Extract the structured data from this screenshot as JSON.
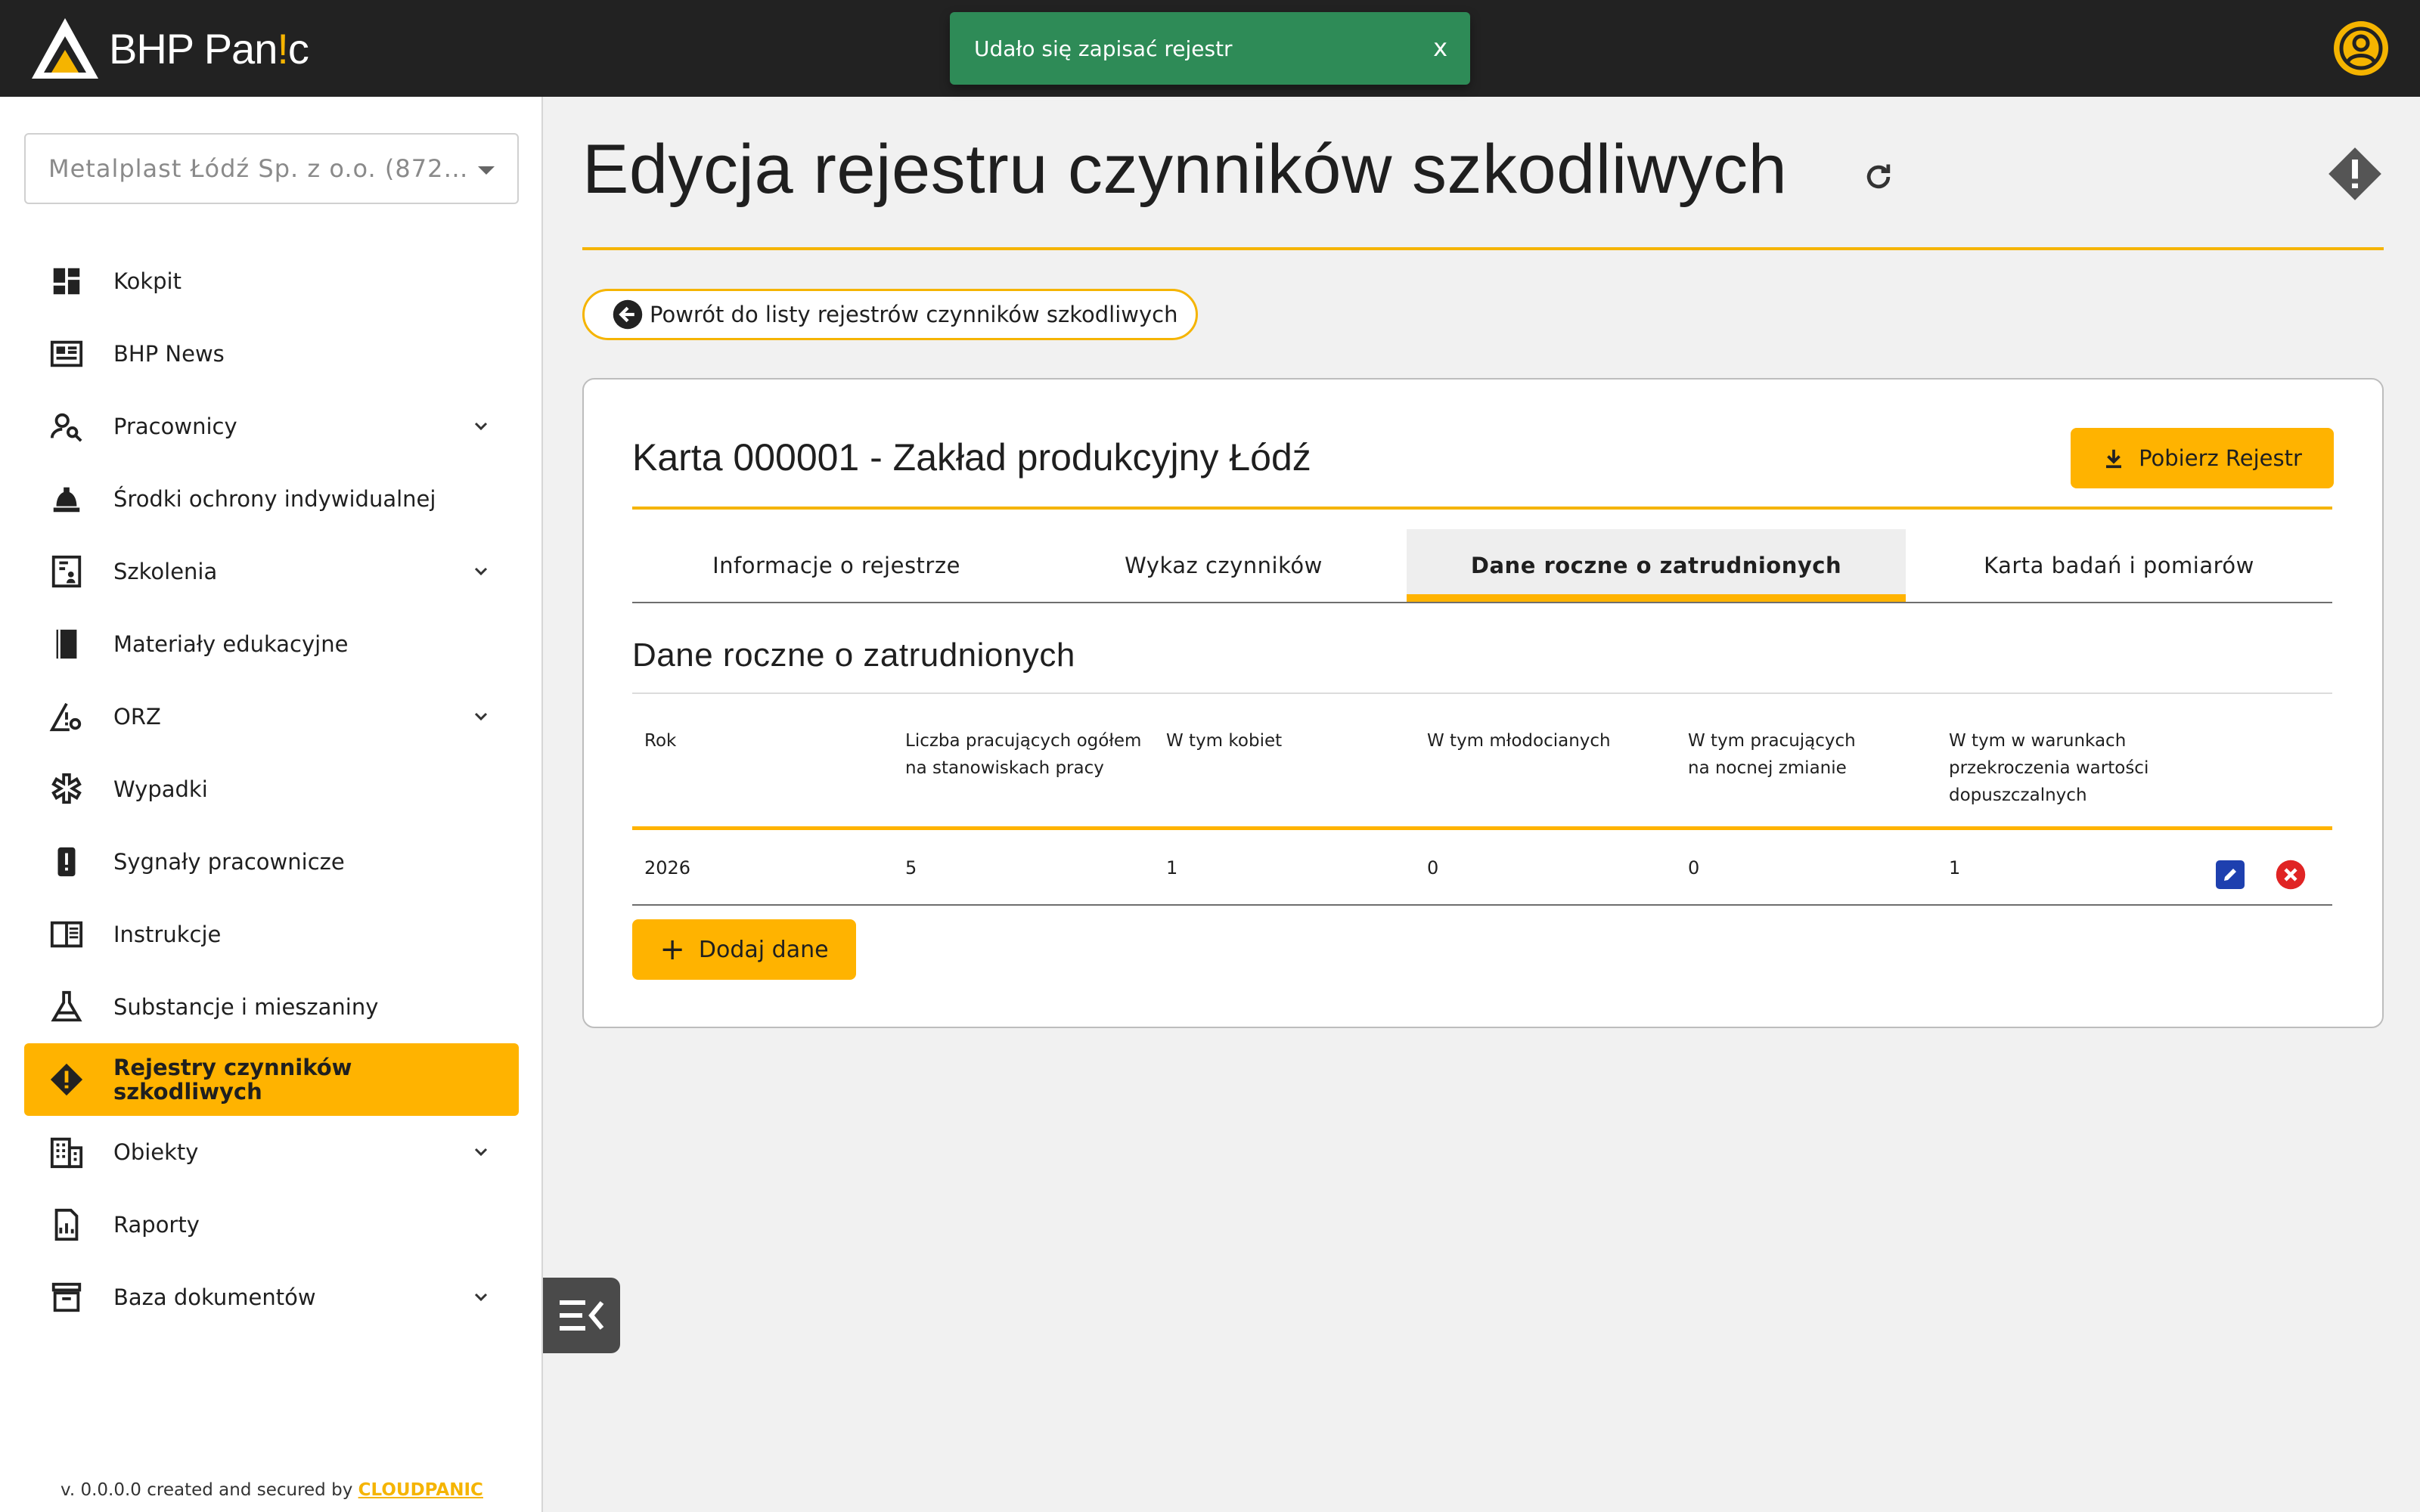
{
  "brand": {
    "name_part1": "BHP Pan",
    "name_accent": "!",
    "name_part2": "c",
    "accent_color": "#f5b400"
  },
  "toast": {
    "message": "Udało się zapisać rejestr",
    "close_label": "x",
    "color": "#2e8b57"
  },
  "sidebar": {
    "company_select": "Metalplast Łódź Sp. z o.o. (8721...",
    "items": [
      {
        "label": "Kokpit",
        "icon": "dashboard-icon",
        "expandable": false
      },
      {
        "label": "BHP News",
        "icon": "news-icon",
        "expandable": false
      },
      {
        "label": "Pracownicy",
        "icon": "person-search-icon",
        "expandable": true
      },
      {
        "label": "Środki ochrony indywidualnej",
        "icon": "helmet-icon",
        "expandable": false
      },
      {
        "label": "Szkolenia",
        "icon": "training-icon",
        "expandable": true
      },
      {
        "label": "Materiały edukacyjne",
        "icon": "book-icon",
        "expandable": false
      },
      {
        "label": "ORZ",
        "icon": "risk-icon",
        "expandable": true
      },
      {
        "label": "Wypadki",
        "icon": "medical-icon",
        "expandable": false
      },
      {
        "label": "Sygnały pracownicze",
        "icon": "signal-icon",
        "expandable": false
      },
      {
        "label": "Instrukcje",
        "icon": "manual-icon",
        "expandable": false
      },
      {
        "label": "Substancje i mieszaniny",
        "icon": "flask-icon",
        "expandable": false
      },
      {
        "label": "Rejestry czynników szkodliwych",
        "icon": "warning-diamond-icon",
        "expandable": false,
        "active": true
      },
      {
        "label": "Obiekty",
        "icon": "building-icon",
        "expandable": true
      },
      {
        "label": "Raporty",
        "icon": "report-icon",
        "expandable": false
      },
      {
        "label": "Baza dokumentów",
        "icon": "archive-icon",
        "expandable": true
      }
    ],
    "footer_text": "v. 0.0.0.0 created and secured by ",
    "footer_link": "CLOUDPANIC"
  },
  "page": {
    "title": "Edycja rejestru czynników szkodliwych",
    "back_label": "Powrót do listy rejestrów czynników szkodliwych"
  },
  "card": {
    "title": "Karta 000001 - Zakład produkcyjny Łódź",
    "download_label": "Pobierz Rejestr",
    "tabs": [
      {
        "label": "Informacje o rejestrze",
        "active": false
      },
      {
        "label": "Wykaz czynników",
        "active": false
      },
      {
        "label": "Dane roczne o zatrudnionych",
        "active": true
      },
      {
        "label": "Karta badań i pomiarów",
        "active": false
      }
    ],
    "section_title": "Dane roczne o zatrudnionych",
    "table": {
      "headers": [
        [
          "Rok"
        ],
        [
          "Liczba pracujących ogółem",
          "na stanowiskach pracy"
        ],
        [
          "W tym kobiet"
        ],
        [
          "W tym młodocianych"
        ],
        [
          "W tym pracujących",
          "na nocnej zmianie"
        ],
        [
          "W tym w warunkach",
          "przekroczenia wartości",
          "dopuszczalnych"
        ]
      ],
      "rows": [
        [
          "2026",
          "5",
          "1",
          "0",
          "0",
          "1"
        ]
      ]
    },
    "add_label": "Dodaj dane"
  }
}
